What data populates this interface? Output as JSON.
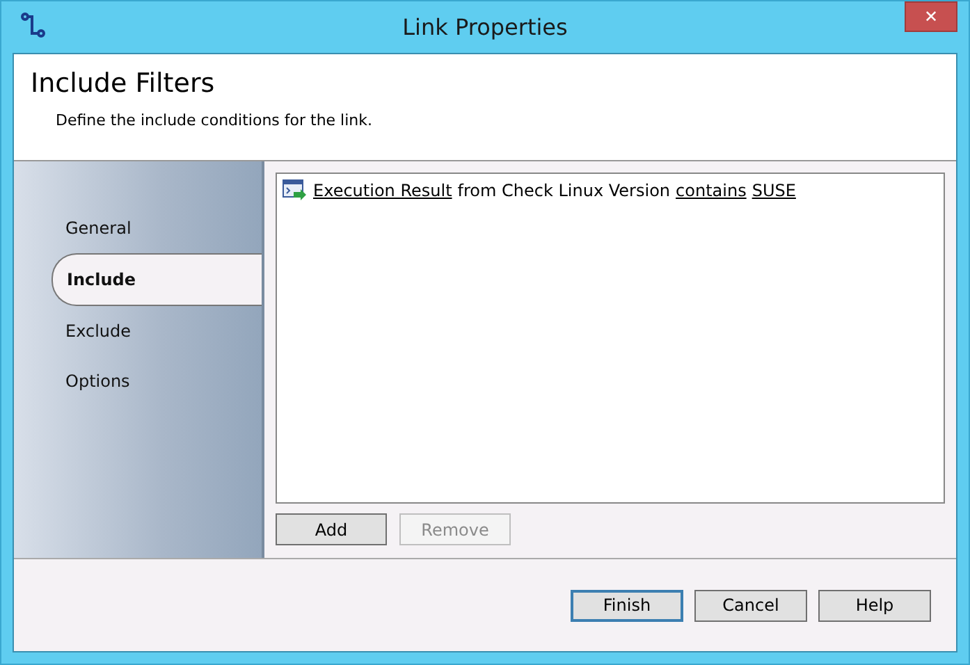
{
  "window": {
    "title": "Link Properties",
    "close": "✕"
  },
  "header": {
    "title": "Include Filters",
    "subtitle": "Define the include conditions for the link."
  },
  "sidebar": {
    "items": [
      {
        "label": "General",
        "selected": false
      },
      {
        "label": "Include",
        "selected": true
      },
      {
        "label": "Exclude",
        "selected": false
      },
      {
        "label": "Options",
        "selected": false
      }
    ]
  },
  "filters": [
    {
      "parts": [
        {
          "text": "Execution Result",
          "link": true
        },
        {
          "text": "from Check Linux Version",
          "link": false
        },
        {
          "text": "contains",
          "link": true
        },
        {
          "text": "SUSE",
          "link": true
        }
      ]
    }
  ],
  "list_buttons": [
    {
      "label": "Add",
      "disabled": false
    },
    {
      "label": "Remove",
      "disabled": true
    }
  ],
  "footer_buttons": [
    {
      "label": "Finish",
      "default": true
    },
    {
      "label": "Cancel",
      "default": false
    },
    {
      "label": "Help",
      "default": false
    }
  ]
}
